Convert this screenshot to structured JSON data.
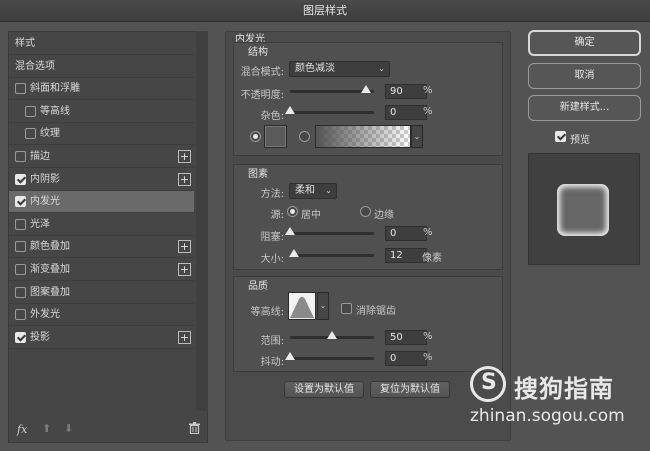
{
  "window": {
    "title": "图层样式"
  },
  "styles_list": {
    "items": [
      {
        "label": "样式",
        "checkbox": false,
        "checked": false,
        "plus": false,
        "selected": false
      },
      {
        "label": "混合选项",
        "checkbox": false,
        "checked": false,
        "plus": false,
        "selected": false
      },
      {
        "label": "斜面和浮雕",
        "checkbox": true,
        "checked": false,
        "plus": false,
        "selected": false
      },
      {
        "label": "等高线",
        "checkbox": true,
        "checked": false,
        "plus": false,
        "selected": false,
        "indent": true
      },
      {
        "label": "纹理",
        "checkbox": true,
        "checked": false,
        "plus": false,
        "selected": false,
        "indent": true
      },
      {
        "label": "描边",
        "checkbox": true,
        "checked": false,
        "plus": true,
        "selected": false
      },
      {
        "label": "内阴影",
        "checkbox": true,
        "checked": true,
        "plus": true,
        "selected": false
      },
      {
        "label": "内发光",
        "checkbox": true,
        "checked": true,
        "plus": false,
        "selected": true
      },
      {
        "label": "光泽",
        "checkbox": true,
        "checked": false,
        "plus": false,
        "selected": false
      },
      {
        "label": "颜色叠加",
        "checkbox": true,
        "checked": false,
        "plus": true,
        "selected": false
      },
      {
        "label": "渐变叠加",
        "checkbox": true,
        "checked": false,
        "plus": true,
        "selected": false
      },
      {
        "label": "图案叠加",
        "checkbox": true,
        "checked": false,
        "plus": false,
        "selected": false
      },
      {
        "label": "外发光",
        "checkbox": true,
        "checked": false,
        "plus": false,
        "selected": false
      },
      {
        "label": "投影",
        "checkbox": true,
        "checked": true,
        "plus": true,
        "selected": false
      }
    ],
    "fx_label": "fx"
  },
  "inner_glow": {
    "title": "内发光",
    "structure": {
      "header": "结构",
      "blend_mode_label": "混合模式:",
      "blend_mode_value": "颜色减淡",
      "opacity_label": "不透明度:",
      "opacity_value": "90",
      "opacity_pct": 90,
      "noise_label": "杂色:",
      "noise_value": "0",
      "noise_pct": 0,
      "unit_pct": "%"
    },
    "elements": {
      "header": "图素",
      "technique_label": "方法:",
      "technique_value": "柔和",
      "source_label": "源:",
      "source_center": "居中",
      "source_edge": "边缘",
      "choke_label": "阻塞:",
      "choke_value": "0",
      "choke_pct": 0,
      "size_label": "大小:",
      "size_value": "12",
      "size_pct": 5,
      "size_unit": "像素",
      "unit_pct": "%"
    },
    "quality": {
      "header": "品质",
      "contour_label": "等高线:",
      "antialias_label": "消除锯齿",
      "range_label": "范围:",
      "range_value": "50",
      "range_pct": 50,
      "jitter_label": "抖动:",
      "jitter_value": "0",
      "jitter_pct": 0,
      "unit_pct": "%"
    },
    "make_default": "设置为默认值",
    "reset_default": "复位为默认值"
  },
  "actions": {
    "ok": "确定",
    "cancel": "取消",
    "new_style": "新建样式...",
    "preview_label": "预览",
    "preview_checked": true
  },
  "watermark": {
    "brand": "搜狗指南",
    "url": "zhinan.sogou.com",
    "logo_letter": "S"
  }
}
